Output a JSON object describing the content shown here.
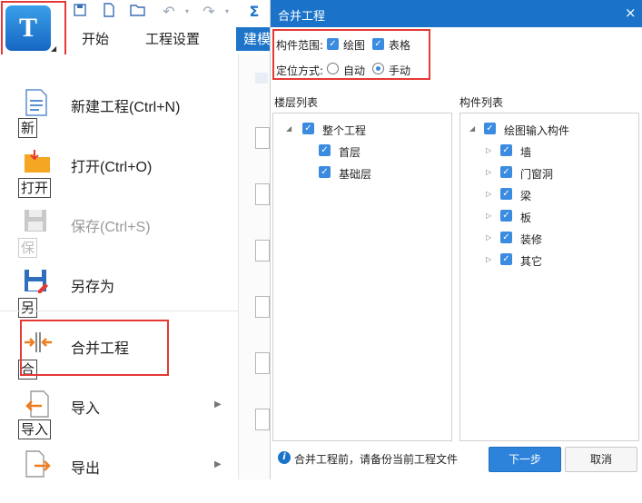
{
  "ribbon": {
    "tabs": [
      "开始",
      "工程设置",
      "建模"
    ],
    "quick_access_icons": [
      "save-icon",
      "new-icon",
      "open-icon",
      "undo-icon",
      "redo-icon",
      "sum-icon"
    ],
    "logo_letter": "T"
  },
  "menu": {
    "items": [
      {
        "label": "新建工程(Ctrl+N)",
        "key": "新",
        "icon": "new-file-icon",
        "disabled": false,
        "arrow": false
      },
      {
        "label": "打开(Ctrl+O)",
        "key": "打开",
        "icon": "open-folder-icon",
        "disabled": false,
        "arrow": false
      },
      {
        "label": "保存(Ctrl+S)",
        "key": "保",
        "icon": "save-icon",
        "disabled": true,
        "arrow": false
      },
      {
        "label": "另存为",
        "key": "另",
        "icon": "save-as-icon",
        "disabled": false,
        "arrow": false
      },
      {
        "label": "合并工程",
        "key": "合",
        "icon": "merge-icon",
        "disabled": false,
        "arrow": false
      },
      {
        "label": "导入",
        "key": "导入",
        "icon": "import-icon",
        "disabled": false,
        "arrow": true
      },
      {
        "label": "导出",
        "key": "导出",
        "icon": "export-icon",
        "disabled": false,
        "arrow": true
      }
    ]
  },
  "dialog": {
    "title": "合并工程",
    "close": "×",
    "scope_label": "构件范围:",
    "scope_options": [
      {
        "label": "绘图",
        "checked": true
      },
      {
        "label": "表格",
        "checked": true
      }
    ],
    "position_label": "定位方式:",
    "position_options": [
      {
        "label": "自动",
        "selected": false
      },
      {
        "label": "手动",
        "selected": true
      }
    ],
    "floor_list_title": "楼层列表",
    "floor_tree": [
      {
        "label": "整个工程",
        "level": 0,
        "checked": true,
        "expander": "◢"
      },
      {
        "label": "首层",
        "level": 1,
        "checked": true,
        "expander": ""
      },
      {
        "label": "基础层",
        "level": 1,
        "checked": true,
        "expander": ""
      }
    ],
    "component_list_title": "构件列表",
    "component_tree": [
      {
        "label": "绘图输入构件",
        "level": 0,
        "checked": true,
        "expander": "◢"
      },
      {
        "label": "墙",
        "level": 1,
        "checked": true,
        "expander": "▷"
      },
      {
        "label": "门窗洞",
        "level": 1,
        "checked": true,
        "expander": "▷"
      },
      {
        "label": "梁",
        "level": 1,
        "checked": true,
        "expander": "▷"
      },
      {
        "label": "板",
        "level": 1,
        "checked": true,
        "expander": "▷"
      },
      {
        "label": "装修",
        "level": 1,
        "checked": true,
        "expander": "▷"
      },
      {
        "label": "其它",
        "level": 1,
        "checked": true,
        "expander": "▷"
      }
    ],
    "info_text": "合并工程前，请备份当前工程文件",
    "next_button": "下一步",
    "cancel_button": "取消"
  },
  "colors": {
    "accent": "#1a73c9",
    "highlight_box": "#e53935",
    "checkbox": "#3b8be0"
  }
}
